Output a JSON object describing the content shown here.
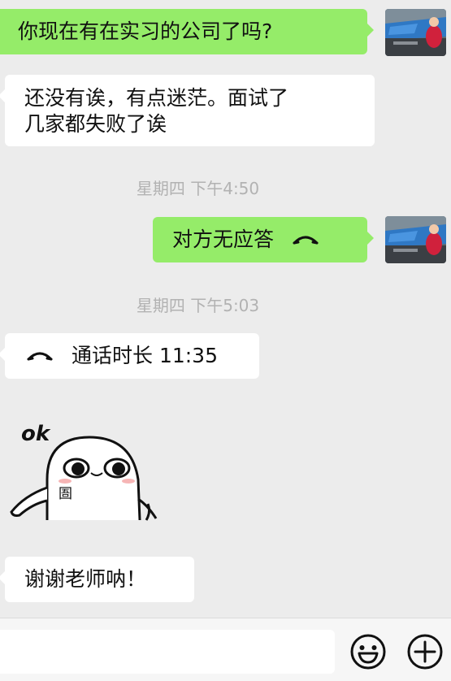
{
  "messages": [
    {
      "side": "right",
      "text": "你现在有在实习的公司了吗?"
    },
    {
      "side": "left",
      "text_line1": "还没有诶，有点迷茫。面试了",
      "text_line2": "几家都失败了诶"
    },
    {
      "timestamp": "星期四 下午4:50"
    },
    {
      "side": "right",
      "text": "对方无应答",
      "icon": "phone-hangup-icon"
    },
    {
      "timestamp": "星期四 下午5:03"
    },
    {
      "side": "left",
      "text": "通话时长 11:35",
      "icon": "phone-hangup-icon"
    },
    {
      "side": "left",
      "sticker": "ok-ghost-sticker",
      "sticker_text": "ok",
      "badge_text": "圄"
    },
    {
      "side": "left",
      "text": "谢谢老师呐！"
    }
  ],
  "input": {
    "value": "",
    "emoji_icon": "smile-icon",
    "plus_icon": "plus-icon"
  },
  "colors": {
    "background": "#ececec",
    "bubble_sent": "#95ec69",
    "bubble_received": "#ffffff",
    "timestamp": "#b2b2b2"
  }
}
